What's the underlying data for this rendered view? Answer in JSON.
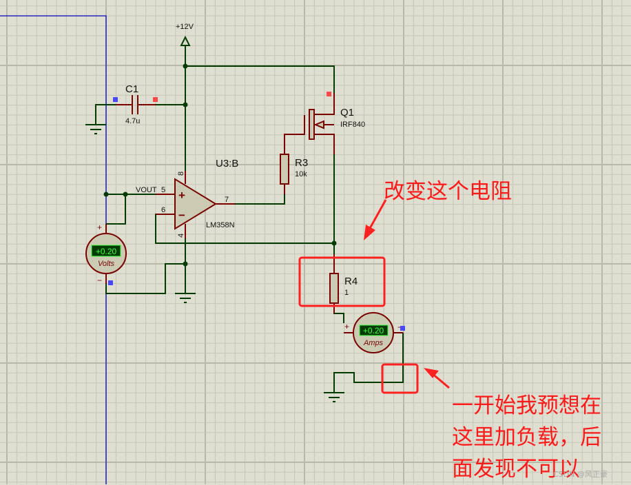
{
  "app": "Proteus ISIS schematic editor",
  "colors": {
    "background": "#dfdfd1",
    "grid_minor": "#c6c6b8",
    "grid_major": "#b8b8a8",
    "wire": "#003c00",
    "component_outline": "#7a0000",
    "component_fill": "#cbcbb3",
    "sheet_border": "#0000c0",
    "pin_positive": "#ff4848",
    "pin_negative": "#4848ff",
    "meter_display_bg": "#003c00",
    "meter_display_text": "#40ff40",
    "annotation": "#ff1a1a"
  },
  "power": {
    "label": "+12V"
  },
  "components": {
    "c1": {
      "ref": "C1",
      "value": "4.7u"
    },
    "q1": {
      "ref": "Q1",
      "value": "IRF840"
    },
    "r3": {
      "ref": "R3",
      "value": "10k"
    },
    "r4": {
      "ref": "R4",
      "value": "1"
    },
    "u3": {
      "ref": "U3:B",
      "value": "LM358N",
      "pins": {
        "noninv": "5",
        "inv": "6",
        "out": "7",
        "vcc": "8",
        "gnd": "4"
      },
      "net_label": "VOUT",
      "plus_sign": "+",
      "minus_sign": "−"
    }
  },
  "voltmeter": {
    "reading": "+0.20",
    "unit": "Volts",
    "plus": "+",
    "minus": "−"
  },
  "ammeter": {
    "reading": "+0.20",
    "unit": "Amps",
    "plus": "+",
    "minus": "−"
  },
  "annotations": {
    "change_resistor": "改变这个电阻",
    "load_note_lines": [
      "一开始我预想在",
      "这里加负载，后",
      "面发现不可以"
    ]
  },
  "watermark": "CSDN @风正豪"
}
